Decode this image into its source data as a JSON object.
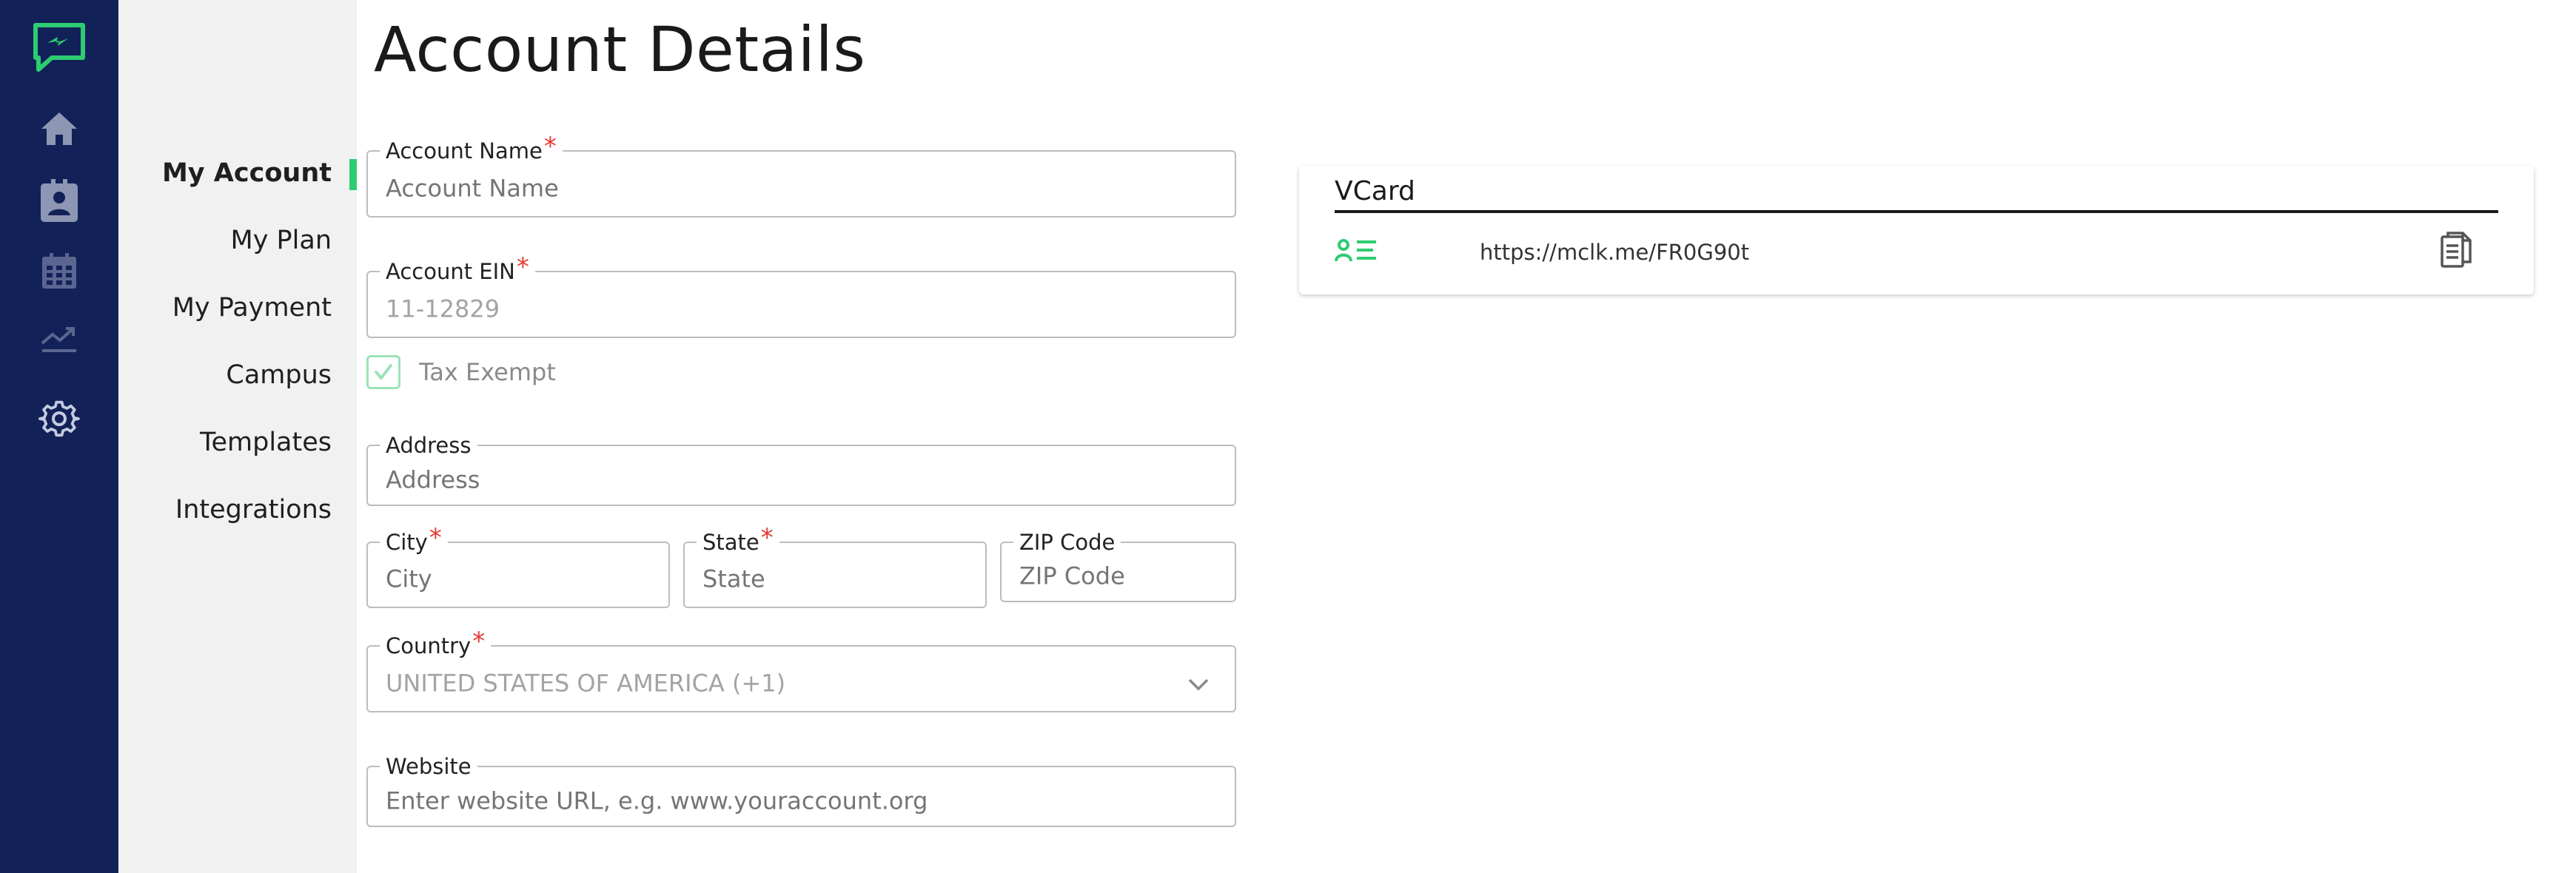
{
  "theme": {
    "rail_bg": "#122258",
    "accent": "#2ecc71",
    "required": "#e53935"
  },
  "rail": {
    "icons": [
      "chat-bolt-logo-icon",
      "home-icon",
      "contacts-icon",
      "calendar-icon",
      "analytics-icon",
      "gear-icon"
    ]
  },
  "subnav": {
    "items": [
      {
        "label": "My Account",
        "active": true
      },
      {
        "label": "My Plan"
      },
      {
        "label": "My Payment"
      },
      {
        "label": "Campus"
      },
      {
        "label": "Templates"
      },
      {
        "label": "Integrations"
      }
    ]
  },
  "page": {
    "title": "Account Details"
  },
  "form": {
    "account_name": {
      "label": "Account Name",
      "required": "*",
      "placeholder": "Account Name"
    },
    "account_ein": {
      "label": "Account EIN",
      "required": "*",
      "value": "11-12829"
    },
    "tax_exempt": {
      "label": "Tax Exempt",
      "checked": true
    },
    "address": {
      "label": "Address",
      "placeholder": "Address"
    },
    "city": {
      "label": "City",
      "required": "*",
      "placeholder": "City"
    },
    "state": {
      "label": "State",
      "required": "*",
      "placeholder": "State"
    },
    "zip": {
      "label": "ZIP Code",
      "placeholder": "ZIP Code"
    },
    "country": {
      "label": "Country",
      "required": "*",
      "value": "UNITED STATES OF AMERICA (+1)"
    },
    "website": {
      "label": "Website",
      "placeholder": "Enter website URL, e.g. www.youraccount.org"
    }
  },
  "vcard": {
    "title": "VCard",
    "url": "https://mclk.me/FR0G90t"
  }
}
